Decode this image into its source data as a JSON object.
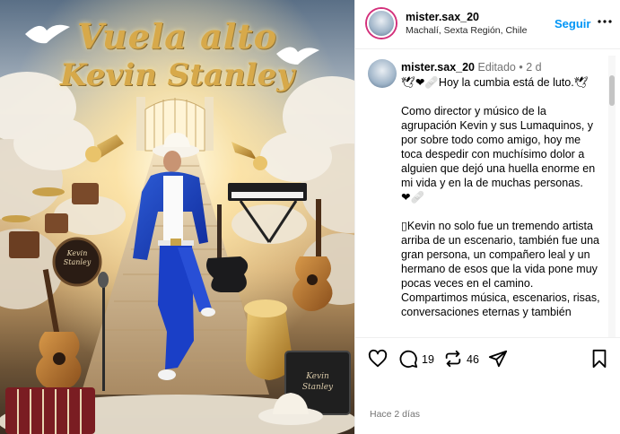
{
  "media": {
    "headline_line1": "Vuela alto",
    "headline_line2": "Kevin Stanley",
    "drum_text": "Kevin Stanley",
    "amp_text": "Kevin Stanley"
  },
  "header": {
    "username": "mister.sax_20",
    "location": "Machalí, Sexta Región, Chile",
    "follow_label": "Seguir",
    "more_icon": "more-horizontal-icon"
  },
  "caption": {
    "username": "mister.sax_20",
    "meta": " Editado • 2 d",
    "line1": "Hoy la cumbia está de luto.",
    "prefix_glyphs": "🕊❤🩹",
    "suffix_glyph": "🕊",
    "paragraph2": "Como director y músico de la agrupación Kevin y sus Lumaquinos, y por sobre todo como amigo, hoy me toca despedir con muchísimo dolor a alguien que dejó una huella enorme en mi vida y en la de muchas personas.",
    "paragraph2_glyphs": "❤🩹",
    "paragraph3": "Kevin no solo fue un tremendo artista arriba de un escenario, también fue una gran persona, un compañero leal y un hermano de esos que la vida pone muy pocas veces en el camino. Compartimos música, escenarios, risas, conversaciones eternas y también",
    "paragraph3_glyph": "▯"
  },
  "actions": {
    "comment_count": "19",
    "repost_count": "46",
    "icons": [
      "heart-icon",
      "comment-icon",
      "repost-icon",
      "share-icon",
      "bookmark-icon"
    ]
  },
  "date": "Hace 2 días",
  "colors": {
    "accent_blue": "#0095f6",
    "meta_gray": "#737373",
    "heart_red": "#ed4956",
    "headline_gold": "#d7a94a"
  }
}
